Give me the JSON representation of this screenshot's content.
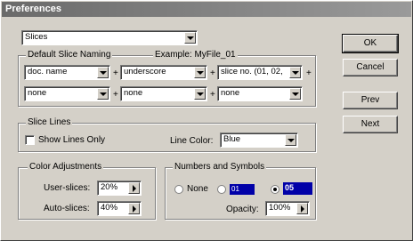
{
  "window": {
    "title": "Preferences"
  },
  "category": {
    "selected": "Slices"
  },
  "buttons": {
    "ok": "OK",
    "cancel": "Cancel",
    "prev": "Prev",
    "next": "Next"
  },
  "naming": {
    "legend": "Default Slice Naming",
    "example": "Example: MyFile_01",
    "row1": [
      "doc. name",
      "underscore",
      "slice no. (01, 02,"
    ],
    "row2": [
      "none",
      "none",
      "none"
    ],
    "plus": "+"
  },
  "slice_lines": {
    "legend": "Slice Lines",
    "show_lines_only": "Show Lines Only",
    "line_color_label": "Line Color:",
    "line_color_value": "Blue"
  },
  "color_adjustments": {
    "legend": "Color Adjustments",
    "user_label": "User-slices:",
    "user_value": "20%",
    "auto_label": "Auto-slices:",
    "auto_value": "40%"
  },
  "numbers_symbols": {
    "legend": "Numbers and Symbols",
    "none_label": "None",
    "swatch1_num": "01",
    "swatch2_num": "05",
    "opacity_label": "Opacity:",
    "opacity_value": "100%",
    "swatch_color": "#0000a8"
  }
}
